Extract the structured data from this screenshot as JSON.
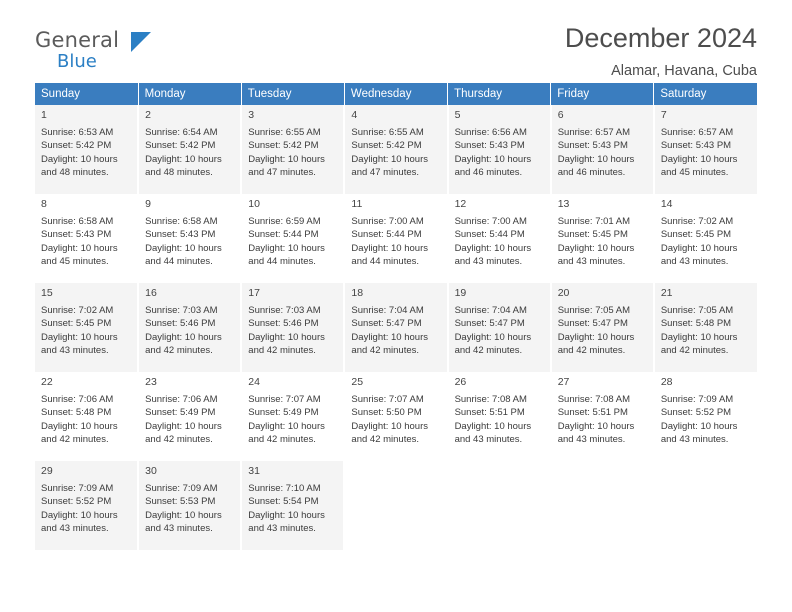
{
  "logo": {
    "word_general": "General",
    "word_blue": "Blue",
    "mark": "triangle-mark"
  },
  "header": {
    "month_title": "December 2024",
    "location": "Alamar, Havana, Cuba"
  },
  "weekdays": [
    "Sunday",
    "Monday",
    "Tuesday",
    "Wednesday",
    "Thursday",
    "Friday",
    "Saturday"
  ],
  "colors": {
    "header_blue": "#3a7dbf",
    "logo_blue": "#2b7fc4",
    "row_shade": "#f4f4f4",
    "text": "#3b3b3b"
  },
  "weeks": [
    [
      {
        "day": "1",
        "sunrise": "Sunrise: 6:53 AM",
        "sunset": "Sunset: 5:42 PM",
        "daylight1": "Daylight: 10 hours",
        "daylight2": "and 48 minutes."
      },
      {
        "day": "2",
        "sunrise": "Sunrise: 6:54 AM",
        "sunset": "Sunset: 5:42 PM",
        "daylight1": "Daylight: 10 hours",
        "daylight2": "and 48 minutes."
      },
      {
        "day": "3",
        "sunrise": "Sunrise: 6:55 AM",
        "sunset": "Sunset: 5:42 PM",
        "daylight1": "Daylight: 10 hours",
        "daylight2": "and 47 minutes."
      },
      {
        "day": "4",
        "sunrise": "Sunrise: 6:55 AM",
        "sunset": "Sunset: 5:42 PM",
        "daylight1": "Daylight: 10 hours",
        "daylight2": "and 47 minutes."
      },
      {
        "day": "5",
        "sunrise": "Sunrise: 6:56 AM",
        "sunset": "Sunset: 5:43 PM",
        "daylight1": "Daylight: 10 hours",
        "daylight2": "and 46 minutes."
      },
      {
        "day": "6",
        "sunrise": "Sunrise: 6:57 AM",
        "sunset": "Sunset: 5:43 PM",
        "daylight1": "Daylight: 10 hours",
        "daylight2": "and 46 minutes."
      },
      {
        "day": "7",
        "sunrise": "Sunrise: 6:57 AM",
        "sunset": "Sunset: 5:43 PM",
        "daylight1": "Daylight: 10 hours",
        "daylight2": "and 45 minutes."
      }
    ],
    [
      {
        "day": "8",
        "sunrise": "Sunrise: 6:58 AM",
        "sunset": "Sunset: 5:43 PM",
        "daylight1": "Daylight: 10 hours",
        "daylight2": "and 45 minutes."
      },
      {
        "day": "9",
        "sunrise": "Sunrise: 6:58 AM",
        "sunset": "Sunset: 5:43 PM",
        "daylight1": "Daylight: 10 hours",
        "daylight2": "and 44 minutes."
      },
      {
        "day": "10",
        "sunrise": "Sunrise: 6:59 AM",
        "sunset": "Sunset: 5:44 PM",
        "daylight1": "Daylight: 10 hours",
        "daylight2": "and 44 minutes."
      },
      {
        "day": "11",
        "sunrise": "Sunrise: 7:00 AM",
        "sunset": "Sunset: 5:44 PM",
        "daylight1": "Daylight: 10 hours",
        "daylight2": "and 44 minutes."
      },
      {
        "day": "12",
        "sunrise": "Sunrise: 7:00 AM",
        "sunset": "Sunset: 5:44 PM",
        "daylight1": "Daylight: 10 hours",
        "daylight2": "and 43 minutes."
      },
      {
        "day": "13",
        "sunrise": "Sunrise: 7:01 AM",
        "sunset": "Sunset: 5:45 PM",
        "daylight1": "Daylight: 10 hours",
        "daylight2": "and 43 minutes."
      },
      {
        "day": "14",
        "sunrise": "Sunrise: 7:02 AM",
        "sunset": "Sunset: 5:45 PM",
        "daylight1": "Daylight: 10 hours",
        "daylight2": "and 43 minutes."
      }
    ],
    [
      {
        "day": "15",
        "sunrise": "Sunrise: 7:02 AM",
        "sunset": "Sunset: 5:45 PM",
        "daylight1": "Daylight: 10 hours",
        "daylight2": "and 43 minutes."
      },
      {
        "day": "16",
        "sunrise": "Sunrise: 7:03 AM",
        "sunset": "Sunset: 5:46 PM",
        "daylight1": "Daylight: 10 hours",
        "daylight2": "and 42 minutes."
      },
      {
        "day": "17",
        "sunrise": "Sunrise: 7:03 AM",
        "sunset": "Sunset: 5:46 PM",
        "daylight1": "Daylight: 10 hours",
        "daylight2": "and 42 minutes."
      },
      {
        "day": "18",
        "sunrise": "Sunrise: 7:04 AM",
        "sunset": "Sunset: 5:47 PM",
        "daylight1": "Daylight: 10 hours",
        "daylight2": "and 42 minutes."
      },
      {
        "day": "19",
        "sunrise": "Sunrise: 7:04 AM",
        "sunset": "Sunset: 5:47 PM",
        "daylight1": "Daylight: 10 hours",
        "daylight2": "and 42 minutes."
      },
      {
        "day": "20",
        "sunrise": "Sunrise: 7:05 AM",
        "sunset": "Sunset: 5:47 PM",
        "daylight1": "Daylight: 10 hours",
        "daylight2": "and 42 minutes."
      },
      {
        "day": "21",
        "sunrise": "Sunrise: 7:05 AM",
        "sunset": "Sunset: 5:48 PM",
        "daylight1": "Daylight: 10 hours",
        "daylight2": "and 42 minutes."
      }
    ],
    [
      {
        "day": "22",
        "sunrise": "Sunrise: 7:06 AM",
        "sunset": "Sunset: 5:48 PM",
        "daylight1": "Daylight: 10 hours",
        "daylight2": "and 42 minutes."
      },
      {
        "day": "23",
        "sunrise": "Sunrise: 7:06 AM",
        "sunset": "Sunset: 5:49 PM",
        "daylight1": "Daylight: 10 hours",
        "daylight2": "and 42 minutes."
      },
      {
        "day": "24",
        "sunrise": "Sunrise: 7:07 AM",
        "sunset": "Sunset: 5:49 PM",
        "daylight1": "Daylight: 10 hours",
        "daylight2": "and 42 minutes."
      },
      {
        "day": "25",
        "sunrise": "Sunrise: 7:07 AM",
        "sunset": "Sunset: 5:50 PM",
        "daylight1": "Daylight: 10 hours",
        "daylight2": "and 42 minutes."
      },
      {
        "day": "26",
        "sunrise": "Sunrise: 7:08 AM",
        "sunset": "Sunset: 5:51 PM",
        "daylight1": "Daylight: 10 hours",
        "daylight2": "and 43 minutes."
      },
      {
        "day": "27",
        "sunrise": "Sunrise: 7:08 AM",
        "sunset": "Sunset: 5:51 PM",
        "daylight1": "Daylight: 10 hours",
        "daylight2": "and 43 minutes."
      },
      {
        "day": "28",
        "sunrise": "Sunrise: 7:09 AM",
        "sunset": "Sunset: 5:52 PM",
        "daylight1": "Daylight: 10 hours",
        "daylight2": "and 43 minutes."
      }
    ],
    [
      {
        "day": "29",
        "sunrise": "Sunrise: 7:09 AM",
        "sunset": "Sunset: 5:52 PM",
        "daylight1": "Daylight: 10 hours",
        "daylight2": "and 43 minutes."
      },
      {
        "day": "30",
        "sunrise": "Sunrise: 7:09 AM",
        "sunset": "Sunset: 5:53 PM",
        "daylight1": "Daylight: 10 hours",
        "daylight2": "and 43 minutes."
      },
      {
        "day": "31",
        "sunrise": "Sunrise: 7:10 AM",
        "sunset": "Sunset: 5:54 PM",
        "daylight1": "Daylight: 10 hours",
        "daylight2": "and 43 minutes."
      },
      null,
      null,
      null,
      null
    ]
  ]
}
